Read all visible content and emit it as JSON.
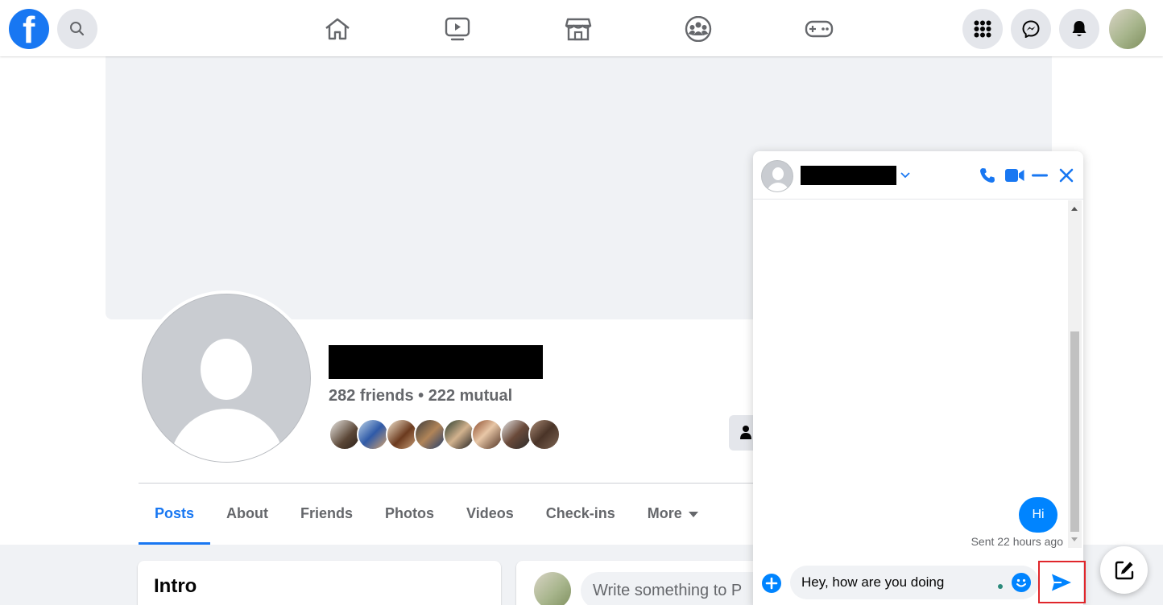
{
  "topbar": {
    "logo_letter": "f",
    "nav": [
      "home-icon",
      "watch-icon",
      "marketplace-icon",
      "groups-icon",
      "gaming-icon"
    ],
    "right": [
      "menu-icon",
      "messenger-icon",
      "notifications-icon",
      "account-avatar"
    ]
  },
  "profile": {
    "friends_text": "282 friends • 222 mutual",
    "tabs": [
      "Posts",
      "About",
      "Friends",
      "Photos",
      "Videos",
      "Check-ins",
      "More"
    ],
    "active_tab": "Posts"
  },
  "intro": {
    "title": "Intro"
  },
  "composer": {
    "placeholder": "Write something to P"
  },
  "chat": {
    "messages": [
      {
        "text": "Hi",
        "from": "me"
      }
    ],
    "sent_status": "Sent 22 hours ago",
    "draft": "Hey, how are you doing"
  },
  "colors": {
    "brand": "#1877f2",
    "messenger": "#0084ff",
    "highlight": "#e0262b"
  }
}
